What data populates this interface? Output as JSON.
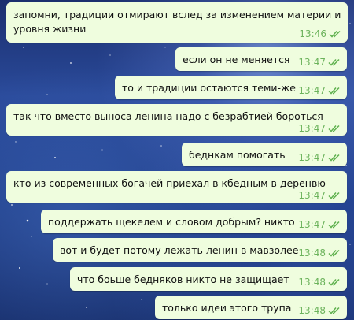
{
  "messages": [
    {
      "lines": [
        "запомни, традиции отмирают вслед за изменением материи и",
        "уровня жизни"
      ],
      "time": "13:46"
    },
    {
      "lines": [
        "если он не меняется"
      ],
      "time": "13:47"
    },
    {
      "lines": [
        "то и традиции остаются теми-же"
      ],
      "time": "13:47"
    },
    {
      "lines": [
        "так что вместо выноса ленина надо с безрабтией бороться"
      ],
      "time": "13:47"
    },
    {
      "lines": [
        "беднкам помогать"
      ],
      "time": "13:47"
    },
    {
      "lines": [
        "кто из современных богачей приехал в кбедным в деренвю"
      ],
      "time": "13:47"
    },
    {
      "lines": [
        "поддержать щекелем и словом добрым? никто"
      ],
      "time": "13:47"
    },
    {
      "lines": [
        "вот и будет потому лежать ленин в мавзолее"
      ],
      "time": "13:48"
    },
    {
      "lines": [
        "что боьше бедняков никто не защищает"
      ],
      "time": "13:48"
    },
    {
      "lines": [
        "только идеи этого трупа"
      ],
      "time": "13:48"
    }
  ],
  "status": "read",
  "colors": {
    "bubble": "#effdde",
    "time": "#6cb35c",
    "check": "#5fb14e"
  },
  "icons": {
    "read_receipt": "double-check-icon"
  }
}
